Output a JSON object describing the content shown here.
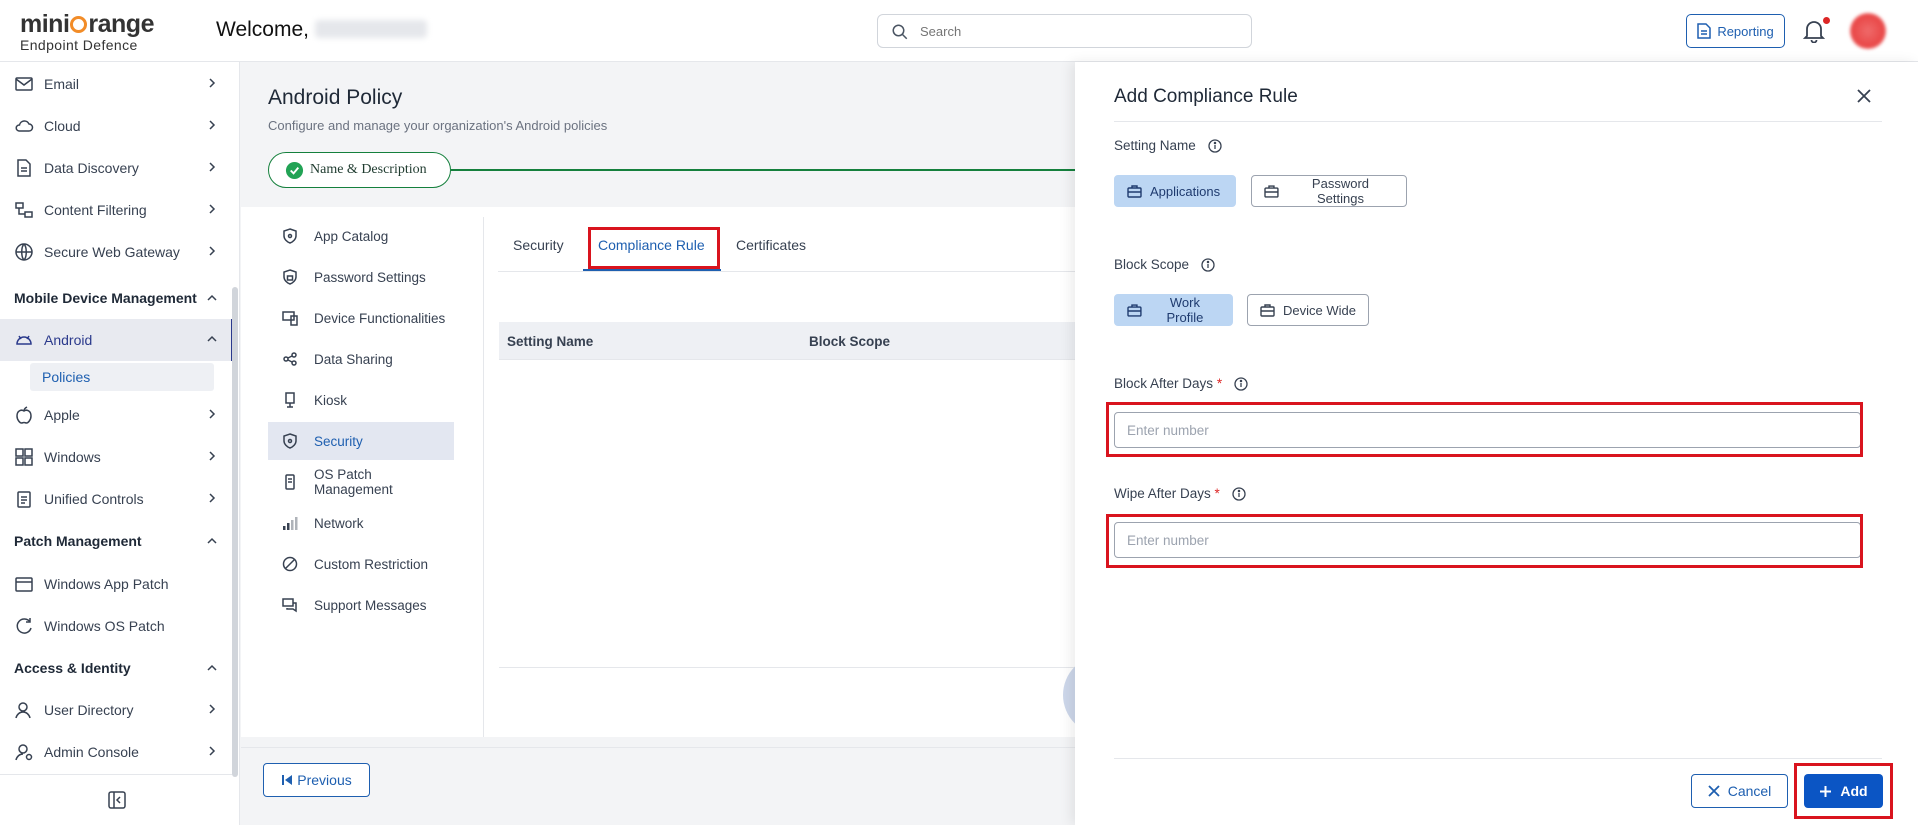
{
  "header": {
    "logo_main_left": "mini",
    "logo_main_right": "range",
    "logo_sub": "Endpoint Defence",
    "welcome": "Welcome,",
    "search_placeholder": "Search",
    "reporting_label": "Reporting"
  },
  "sidebar": {
    "items_top": [
      {
        "label": "Email",
        "icon": "mail-icon"
      },
      {
        "label": "Cloud",
        "icon": "cloud-icon"
      },
      {
        "label": "Data Discovery",
        "icon": "document-icon"
      },
      {
        "label": "Content Filtering",
        "icon": "filter-icon"
      },
      {
        "label": "Secure Web Gateway",
        "icon": "globe-icon"
      }
    ],
    "section_mdm": "Mobile Device Management",
    "android": "Android",
    "policies": "Policies",
    "items_mdm": [
      {
        "label": "Apple",
        "icon": "apple-icon"
      },
      {
        "label": "Windows",
        "icon": "windows-icon"
      },
      {
        "label": "Unified Controls",
        "icon": "clipboard-icon"
      }
    ],
    "section_patch": "Patch Management",
    "items_patch": [
      {
        "label": "Windows App Patch",
        "icon": "calendar-icon"
      },
      {
        "label": "Windows OS Patch",
        "icon": "refresh-icon"
      }
    ],
    "section_access": "Access & Identity",
    "items_access": [
      {
        "label": "User Directory",
        "icon": "user-icon"
      },
      {
        "label": "Admin Console",
        "icon": "admin-icon"
      }
    ]
  },
  "main": {
    "title": "Android Policy",
    "subtitle": "Configure and manage your organization's Android policies",
    "step_label": "Name & Description",
    "policy_nav": [
      {
        "label": "App Catalog"
      },
      {
        "label": "Password Settings"
      },
      {
        "label": "Device Functionalities"
      },
      {
        "label": "Data Sharing"
      },
      {
        "label": "Kiosk"
      },
      {
        "label": "Security",
        "active": true
      },
      {
        "label": "OS Patch Management"
      },
      {
        "label": "Network"
      },
      {
        "label": "Custom Restriction"
      },
      {
        "label": "Support Messages"
      }
    ],
    "tabs": {
      "security": "Security",
      "compliance": "Compliance Rule",
      "certificates": "Certificates"
    },
    "table_headers": {
      "setting_name": "Setting Name",
      "block_scope": "Block Scope"
    },
    "previous_label": "Previous"
  },
  "drawer": {
    "title": "Add Compliance Rule",
    "setting_name_label": "Setting Name",
    "setting_options": {
      "applications": "Applications",
      "password": "Password Settings"
    },
    "block_scope_label": "Block Scope",
    "scope_options": {
      "work": "Work Profile",
      "device": "Device Wide"
    },
    "block_after_label": "Block After Days",
    "wipe_after_label": "Wipe After Days",
    "required_mark": "*",
    "number_placeholder": "Enter number",
    "cancel_label": "Cancel",
    "add_label": "Add"
  },
  "colors": {
    "primary": "#1e5fb0",
    "add_button": "#0b55c4",
    "selected_option": "#bcd6f3",
    "highlight": "#d9141e",
    "success": "#15803d",
    "logo_accent": "#f28c28"
  }
}
